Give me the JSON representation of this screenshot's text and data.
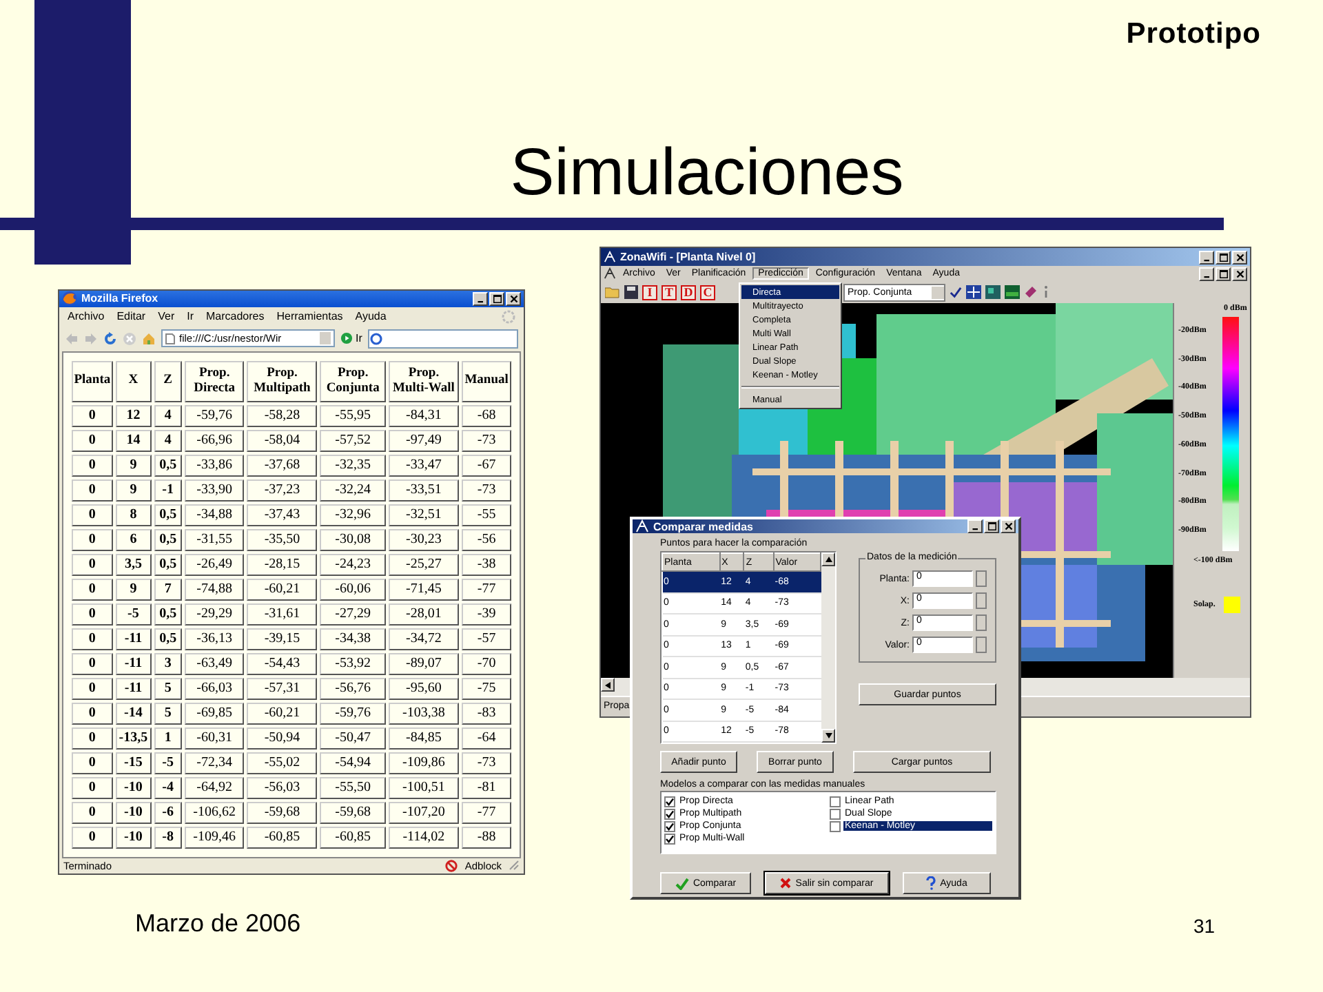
{
  "slide": {
    "label": "Prototipo",
    "title": "Simulaciones",
    "date": "Marzo de 2006",
    "page_number": "31"
  },
  "browser": {
    "title": "Mozilla Firefox",
    "menu": [
      "Archivo",
      "Editar",
      "Ver",
      "Ir",
      "Marcadores",
      "Herramientas",
      "Ayuda"
    ],
    "url": "file:///C:/usr/nestor/Wir",
    "go_button": "Ir",
    "table": {
      "columns": [
        "Planta",
        "X",
        "Z",
        "Prop.\nDirecta",
        "Prop.\nMultipath",
        "Prop.\nConjunta",
        "Prop.\nMulti-Wall",
        "Manual"
      ],
      "rows": [
        [
          "0",
          "12",
          "4",
          "-59,76",
          "-58,28",
          "-55,95",
          "-84,31",
          "-68"
        ],
        [
          "0",
          "14",
          "4",
          "-66,96",
          "-58,04",
          "-57,52",
          "-97,49",
          "-73"
        ],
        [
          "0",
          "9",
          "0,5",
          "-33,86",
          "-37,68",
          "-32,35",
          "-33,47",
          "-67"
        ],
        [
          "0",
          "9",
          "-1",
          "-33,90",
          "-37,23",
          "-32,24",
          "-33,51",
          "-73"
        ],
        [
          "0",
          "8",
          "0,5",
          "-34,88",
          "-37,43",
          "-32,96",
          "-32,51",
          "-55"
        ],
        [
          "0",
          "6",
          "0,5",
          "-31,55",
          "-35,50",
          "-30,08",
          "-30,23",
          "-56"
        ],
        [
          "0",
          "3,5",
          "0,5",
          "-26,49",
          "-28,15",
          "-24,23",
          "-25,27",
          "-38"
        ],
        [
          "0",
          "9",
          "7",
          "-74,88",
          "-60,21",
          "-60,06",
          "-71,45",
          "-77"
        ],
        [
          "0",
          "-5",
          "0,5",
          "-29,29",
          "-31,61",
          "-27,29",
          "-28,01",
          "-39"
        ],
        [
          "0",
          "-11",
          "0,5",
          "-36,13",
          "-39,15",
          "-34,38",
          "-34,72",
          "-57"
        ],
        [
          "0",
          "-11",
          "3",
          "-63,49",
          "-54,43",
          "-53,92",
          "-89,07",
          "-70"
        ],
        [
          "0",
          "-11",
          "5",
          "-66,03",
          "-57,31",
          "-56,76",
          "-95,60",
          "-75"
        ],
        [
          "0",
          "-14",
          "5",
          "-69,85",
          "-60,21",
          "-59,76",
          "-103,38",
          "-83"
        ],
        [
          "0",
          "-13,5",
          "1",
          "-60,31",
          "-50,94",
          "-50,47",
          "-84,85",
          "-64"
        ],
        [
          "0",
          "-15",
          "-5",
          "-72,34",
          "-55,02",
          "-54,94",
          "-109,86",
          "-73"
        ],
        [
          "0",
          "-10",
          "-4",
          "-64,92",
          "-56,03",
          "-55,50",
          "-100,51",
          "-81"
        ],
        [
          "0",
          "-10",
          "-6",
          "-106,62",
          "-59,68",
          "-59,68",
          "-107,20",
          "-77"
        ],
        [
          "0",
          "-10",
          "-8",
          "-109,46",
          "-60,85",
          "-60,85",
          "-114,02",
          "-88"
        ]
      ]
    },
    "status": "Terminado",
    "status_extension": "Adblock"
  },
  "app": {
    "title": "ZonaWifi - [Planta Nivel 0]",
    "menu": [
      {
        "label": "Archivo",
        "expanded": false
      },
      {
        "label": "Ver",
        "expanded": false
      },
      {
        "label": "Planificación",
        "expanded": false
      },
      {
        "label": "Predicción",
        "expanded": true
      },
      {
        "label": "Configuración",
        "expanded": false
      },
      {
        "label": "Ventana",
        "expanded": false
      },
      {
        "label": "Ayuda",
        "expanded": false
      }
    ],
    "tool_letters": [
      "I",
      "T",
      "D",
      "C"
    ],
    "model_select": "Prop. Conjunta",
    "dropdown_groups": [
      {
        "items": [
          {
            "label": "Directa",
            "selected": true
          },
          {
            "label": "Multitrayecto",
            "selected": false
          },
          {
            "label": "Completa",
            "selected": false
          },
          {
            "label": "Multi Wall",
            "selected": false
          },
          {
            "label": "Linear Path",
            "selected": false
          },
          {
            "label": "Dual Slope",
            "selected": false
          },
          {
            "label": "Keenan - Motley",
            "selected": false
          }
        ]
      },
      {
        "items": [
          {
            "label": "Manual",
            "selected": false
          }
        ]
      }
    ],
    "legend": {
      "labels": [
        "0 dBm",
        "-20dBm",
        "-30dBm",
        "-40dBm",
        "-50dBm",
        "-60dBm",
        "-70dBm",
        "-80dBm",
        "-90dBm",
        "<-100 dBm"
      ],
      "overlap_label": "Solap."
    },
    "status": "Propa"
  },
  "dialog": {
    "title": "Comparar medidas",
    "points_label": "Puntos para hacer la comparación",
    "points": {
      "columns": [
        "Planta",
        "X",
        "Z",
        "Valor"
      ],
      "rows": [
        {
          "cells": [
            "0",
            "12",
            "4",
            "-68"
          ],
          "selected": true
        },
        {
          "cells": [
            "0",
            "14",
            "4",
            "-73"
          ],
          "selected": false
        },
        {
          "cells": [
            "0",
            "9",
            "3,5",
            "-69"
          ],
          "selected": false
        },
        {
          "cells": [
            "0",
            "13",
            "1",
            "-69"
          ],
          "selected": false
        },
        {
          "cells": [
            "0",
            "9",
            "0,5",
            "-67"
          ],
          "selected": false
        },
        {
          "cells": [
            "0",
            "9",
            "-1",
            "-73"
          ],
          "selected": false
        },
        {
          "cells": [
            "0",
            "9",
            "-5",
            "-84"
          ],
          "selected": false
        },
        {
          "cells": [
            "0",
            "12",
            "-5",
            "-78"
          ],
          "selected": false
        }
      ]
    },
    "group_title": "Datos de la medición",
    "fields": [
      {
        "label": "Planta:",
        "value": "0"
      },
      {
        "label": "X:",
        "value": "0"
      },
      {
        "label": "Z:",
        "value": "0"
      },
      {
        "label": "Valor:",
        "value": "0"
      }
    ],
    "save_button": "Guardar puntos",
    "add_button": "Añadir punto",
    "delete_button": "Borrar punto",
    "load_button": "Cargar puntos",
    "models_label": "Modelos a comparar con las medidas manuales",
    "models": [
      {
        "label": "Prop Directa",
        "checked": true,
        "selected": false
      },
      {
        "label": "Prop Multipath",
        "checked": true,
        "selected": false
      },
      {
        "label": "Prop Conjunta",
        "checked": true,
        "selected": false
      },
      {
        "label": "Prop Multi-Wall",
        "checked": true,
        "selected": false
      },
      {
        "label": "Linear Path",
        "checked": false,
        "selected": false
      },
      {
        "label": "Dual Slope",
        "checked": false,
        "selected": false
      },
      {
        "label": "Keenan - Motley",
        "checked": false,
        "selected": true
      }
    ],
    "buttons": [
      {
        "kind": "confirm",
        "label": "Comparar"
      },
      {
        "kind": "cancel",
        "label": "Salir sin comparar"
      },
      {
        "kind": "help",
        "label": "Ayuda"
      }
    ]
  }
}
